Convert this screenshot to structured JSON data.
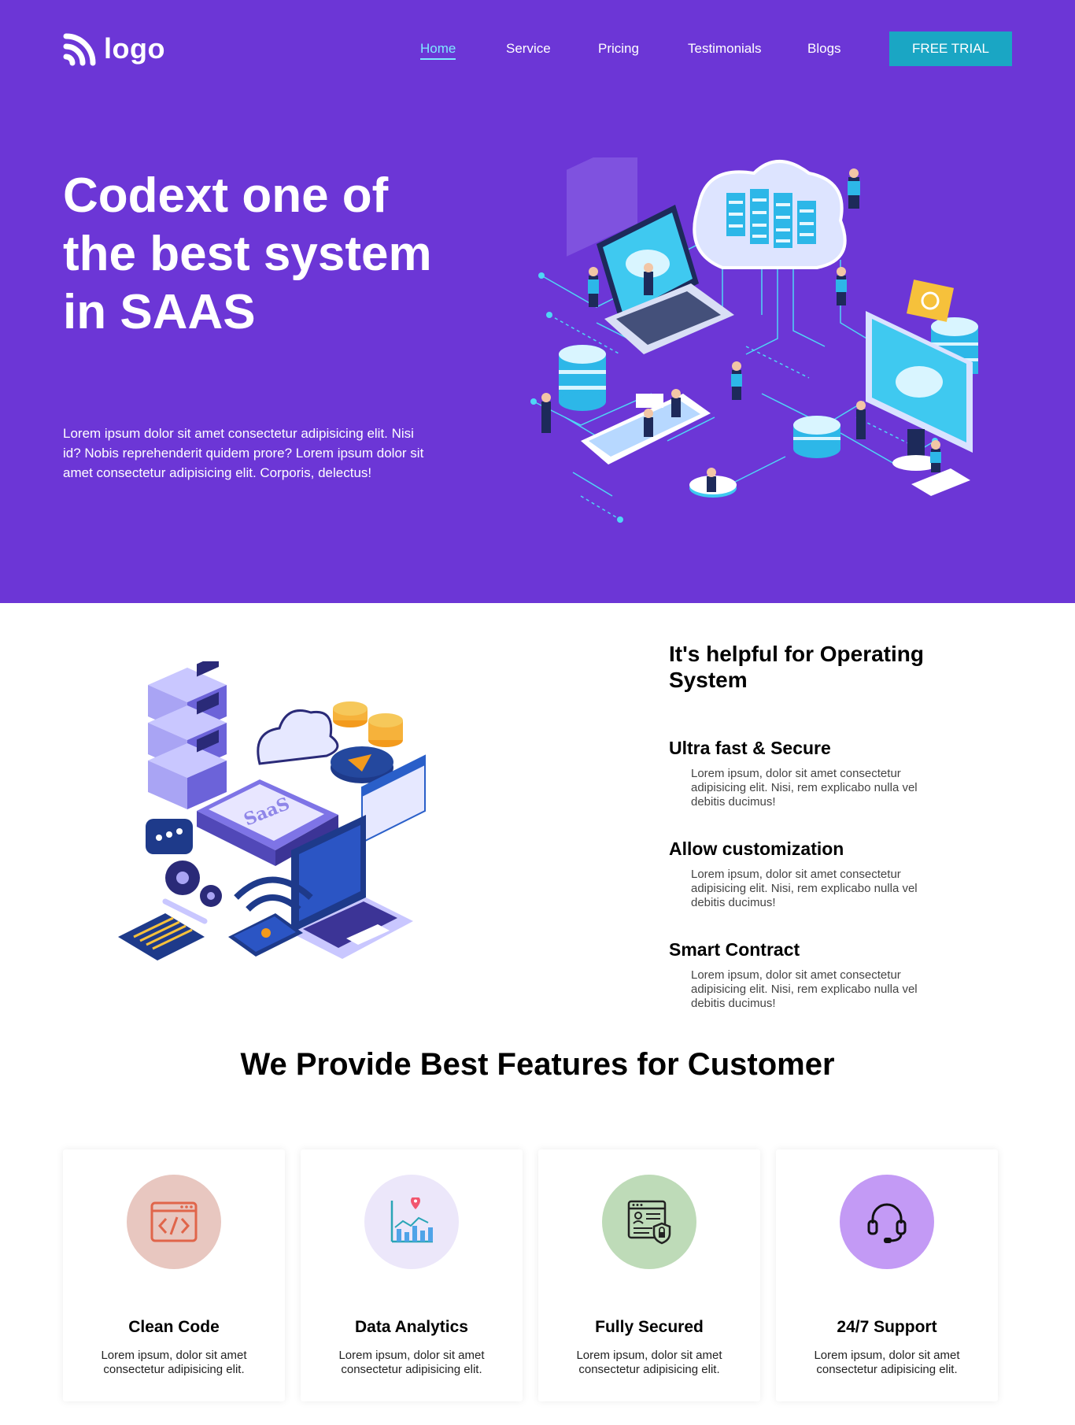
{
  "header": {
    "logo_text": "logo",
    "nav": [
      {
        "label": "Home",
        "active": true
      },
      {
        "label": "Service"
      },
      {
        "label": "Pricing"
      },
      {
        "label": "Testimonials"
      },
      {
        "label": "Blogs"
      }
    ],
    "cta_label": "FREE TRIAL"
  },
  "hero": {
    "title": "Codext one of the best system in SAAS",
    "text": "Lorem ipsum dolor sit amet consectetur adipisicing elit. Nisi id? Nobis reprehenderit quidem prore? Lorem ipsum dolor sit amet consectetur adipisicing elit. Corporis, delectus!"
  },
  "os_section": {
    "title": "It's helpful for Operating System",
    "art_label": "SaaS",
    "features": [
      {
        "title": "Ultra fast & Secure",
        "text": "Lorem ipsum, dolor sit amet consectetur adipisicing elit. Nisi, rem explicabo nulla vel debitis ducimus!"
      },
      {
        "title": "Allow customization",
        "text": "Lorem ipsum, dolor sit amet consectetur adipisicing elit. Nisi, rem explicabo nulla vel debitis ducimus!"
      },
      {
        "title": "Smart Contract",
        "text": "Lorem ipsum, dolor sit amet consectetur adipisicing elit. Nisi, rem explicabo nulla vel debitis ducimus!"
      }
    ]
  },
  "features_section": {
    "title": "We Provide Best Features for Customer",
    "cards": [
      {
        "title": "Clean Code",
        "text": "Lorem ipsum, dolor sit amet consectetur adipisicing elit.",
        "icon": "code-window-icon",
        "bg": "#e8c7c0"
      },
      {
        "title": "Data Analytics",
        "text": "Lorem ipsum, dolor sit amet consectetur adipisicing elit.",
        "icon": "analytics-chart-icon",
        "bg": "#ece7fa"
      },
      {
        "title": "Fully Secured",
        "text": "Lorem ipsum, dolor sit amet consectetur adipisicing elit.",
        "icon": "secure-document-icon",
        "bg": "#bedbb8"
      },
      {
        "title": "24/7 Support",
        "text": "Lorem ipsum, dolor sit amet consectetur adipisicing elit.",
        "icon": "headset-icon",
        "bg": "#c39af5"
      }
    ]
  },
  "colors": {
    "hero_bg": "#6c36d6",
    "cta_bg": "#1aa6c4",
    "nav_active": "#7ee8ff"
  }
}
